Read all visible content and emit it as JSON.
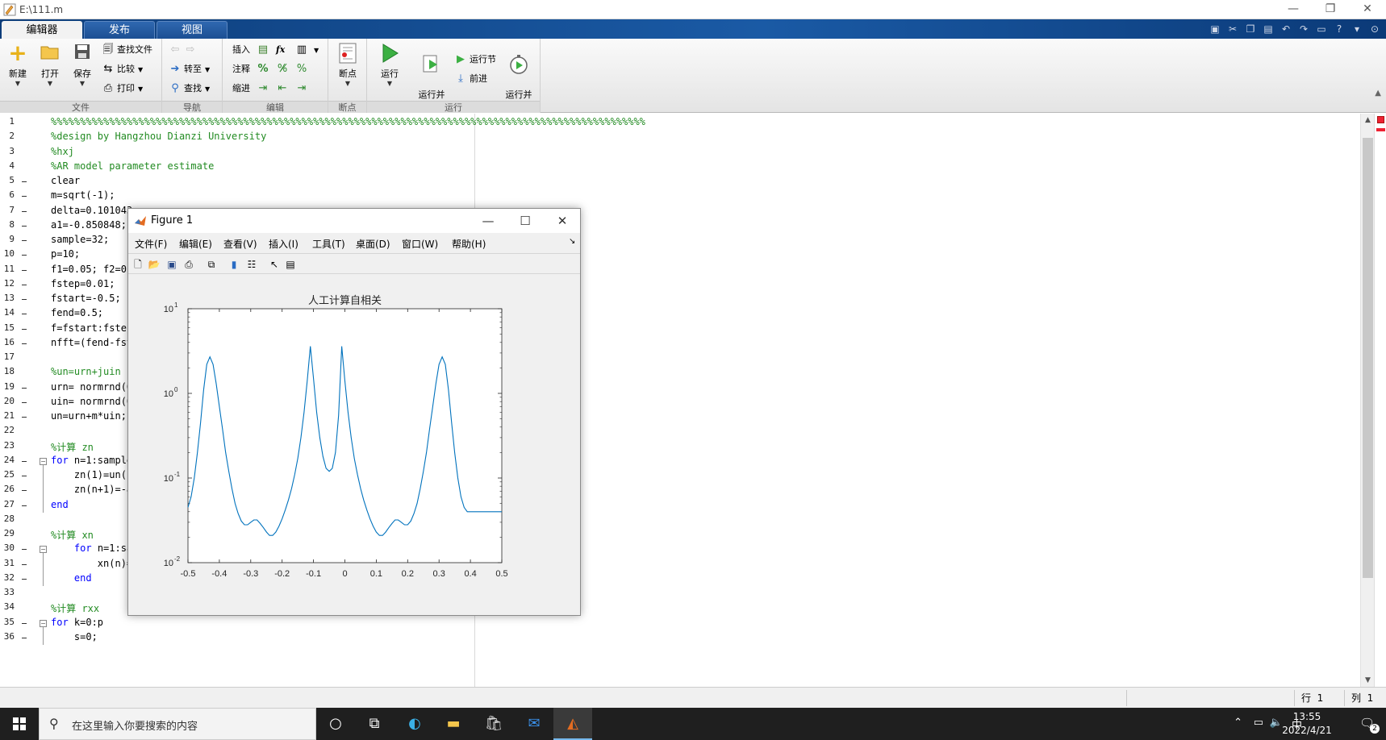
{
  "window": {
    "title": "E:\\111.m",
    "minimize": "—",
    "restore": "❐",
    "close": "✕"
  },
  "tabs": [
    {
      "label": "编辑器",
      "active": true
    },
    {
      "label": "发布",
      "active": false
    },
    {
      "label": "视图",
      "active": false
    }
  ],
  "ribbon": {
    "file": {
      "section": "文件",
      "new": "新建",
      "open": "打开",
      "save": "保存",
      "find_files": "查找文件",
      "compare": "比较",
      "print": "打印"
    },
    "navigate": {
      "section": "导航",
      "goto": "转至",
      "find": "查找"
    },
    "edit": {
      "section": "编辑",
      "insert": "插入",
      "comment": "注释",
      "indent": "缩进",
      "fx": "fx"
    },
    "breakpoints": {
      "section": "断点",
      "breakpoint": "断点"
    },
    "run": {
      "section": "运行",
      "run": "运行",
      "run_advance": "运行并\n前进",
      "run_section": "运行节",
      "advance": "前进",
      "run_time": "运行并\n计时"
    }
  },
  "editor": {
    "lines": [
      {
        "n": "1",
        "text": "%%%%%%%%%%%%%%%%%%%%%%%%%%%%%%%%%%%%%%%%%%%%%%%%%%%%%%%%%%%%%%%%%%%%%%%%%%%%%%%%%%%%%%%%%%%%%%%%%%%%%%",
        "type": "comment",
        "dash": false
      },
      {
        "n": "2",
        "text": "%design by Hangzhou Dianzi University",
        "type": "comment",
        "dash": false
      },
      {
        "n": "3",
        "text": "%hxj",
        "type": "comment",
        "dash": false
      },
      {
        "n": "4",
        "text": "%AR model parameter estimate",
        "type": "comment",
        "dash": false
      },
      {
        "n": "5",
        "text": "clear",
        "type": "code",
        "dash": true
      },
      {
        "n": "6",
        "text": "m=sqrt(-1);",
        "type": "code",
        "dash": true
      },
      {
        "n": "7",
        "text": "delta=0.101043",
        "type": "code",
        "dash": true
      },
      {
        "n": "8",
        "text": "a1=-0.850848;",
        "type": "code",
        "dash": true
      },
      {
        "n": "9",
        "text": "sample=32;",
        "type": "code",
        "dash": true
      },
      {
        "n": "10",
        "text": "p=10;",
        "type": "code",
        "dash": true
      },
      {
        "n": "11",
        "text": "f1=0.05; f2=0.",
        "type": "code",
        "dash": true
      },
      {
        "n": "12",
        "text": "fstep=0.01;",
        "type": "code",
        "dash": true
      },
      {
        "n": "13",
        "text": "fstart=-0.5;",
        "type": "code",
        "dash": true
      },
      {
        "n": "14",
        "text": "fend=0.5;",
        "type": "code",
        "dash": true
      },
      {
        "n": "15",
        "text": "f=fstart:fstep",
        "type": "code",
        "dash": true
      },
      {
        "n": "16",
        "text": "nfft=(fend-fst",
        "type": "code",
        "dash": true
      },
      {
        "n": "17",
        "text": "",
        "type": "code",
        "dash": false
      },
      {
        "n": "18",
        "text": "%un=urn+juin",
        "type": "comment",
        "dash": false
      },
      {
        "n": "19",
        "text": "urn= normrnd(0",
        "type": "code",
        "dash": true
      },
      {
        "n": "20",
        "text": "uin= normrnd(0",
        "type": "code",
        "dash": true
      },
      {
        "n": "21",
        "text": "un=urn+m*uin;",
        "type": "code",
        "dash": true
      },
      {
        "n": "22",
        "text": "",
        "type": "code",
        "dash": false
      },
      {
        "n": "23",
        "text": "%计算 zn",
        "type": "comment",
        "dash": false
      },
      {
        "n": "24",
        "text": "for n=1:sample",
        "type": "for",
        "dash": true
      },
      {
        "n": "25",
        "text": "    zn(1)=un(1",
        "type": "code",
        "dash": true
      },
      {
        "n": "26",
        "text": "    zn(n+1)=-a",
        "type": "code",
        "dash": true
      },
      {
        "n": "27",
        "text": "end",
        "type": "kw",
        "dash": true
      },
      {
        "n": "28",
        "text": "",
        "type": "code",
        "dash": false
      },
      {
        "n": "29",
        "text": "%计算 xn",
        "type": "comment",
        "dash": false
      },
      {
        "n": "30",
        "text": "    for n=1:sa",
        "type": "for",
        "dash": true
      },
      {
        "n": "31",
        "text": "        xn(n)=",
        "type": "code",
        "dash": true
      },
      {
        "n": "32",
        "text": "    end",
        "type": "kw",
        "dash": true
      },
      {
        "n": "33",
        "text": "",
        "type": "code",
        "dash": false
      },
      {
        "n": "34",
        "text": "%计算 rxx",
        "type": "comment",
        "dash": false
      },
      {
        "n": "35",
        "text": "for k=0:p",
        "type": "for",
        "dash": true
      },
      {
        "n": "36",
        "text": "    s=0;",
        "type": "code",
        "dash": true
      }
    ],
    "line31_tail": "));"
  },
  "statusbar": {
    "row_label": "行",
    "row_value": "1",
    "col_label": "列",
    "col_value": "1"
  },
  "taskbar": {
    "search_placeholder": "在这里输入你要搜索的内容",
    "time": "13:55",
    "date": "2022/4/21",
    "ime": "中",
    "notifications": "2"
  },
  "figure": {
    "title": "Figure 1",
    "menu": [
      "文件(F)",
      "编辑(E)",
      "查看(V)",
      "插入(I)",
      "工具(T)",
      "桌面(D)",
      "窗口(W)",
      "帮助(H)"
    ]
  },
  "chart_data": {
    "type": "line",
    "title": "人工计算自相关",
    "xlabel": "",
    "ylabel": "",
    "yscale": "log",
    "xlim": [
      -0.5,
      0.5
    ],
    "ylim": [
      0.01,
      10
    ],
    "xticks": [
      "-0.5",
      "-0.4",
      "-0.3",
      "-0.2",
      "-0.1",
      "0",
      "0.1",
      "0.2",
      "0.3",
      "0.4",
      "0.5"
    ],
    "yticks": [
      {
        "base": "10",
        "exp": "1"
      },
      {
        "base": "10",
        "exp": "0"
      },
      {
        "base": "10",
        "exp": "-1"
      },
      {
        "base": "10",
        "exp": "-2"
      }
    ],
    "color": "#0072BD",
    "grid": false,
    "x": [
      -0.5,
      -0.49,
      -0.48,
      -0.47,
      -0.46,
      -0.45,
      -0.44,
      -0.43,
      -0.42,
      -0.41,
      -0.4,
      -0.39,
      -0.38,
      -0.37,
      -0.36,
      -0.35,
      -0.34,
      -0.33,
      -0.32,
      -0.31,
      -0.3,
      -0.29,
      -0.28,
      -0.27,
      -0.26,
      -0.25,
      -0.24,
      -0.23,
      -0.22,
      -0.21,
      -0.2,
      -0.19,
      -0.18,
      -0.17,
      -0.16,
      -0.15,
      -0.14,
      -0.13,
      -0.12,
      -0.11,
      -0.1,
      -0.09,
      -0.08,
      -0.07,
      -0.06,
      -0.05,
      -0.04,
      -0.03,
      -0.02,
      -0.01,
      0.0,
      0.01,
      0.02,
      0.03,
      0.04,
      0.05,
      0.06,
      0.07,
      0.08,
      0.09,
      0.1,
      0.11,
      0.12,
      0.13,
      0.14,
      0.15,
      0.16,
      0.17,
      0.18,
      0.19,
      0.2,
      0.21,
      0.22,
      0.23,
      0.24,
      0.25,
      0.26,
      0.27,
      0.28,
      0.29,
      0.3,
      0.31,
      0.32,
      0.33,
      0.34,
      0.35,
      0.36,
      0.37,
      0.38,
      0.39,
      0.4,
      0.41,
      0.42,
      0.43,
      0.44,
      0.45,
      0.46,
      0.47,
      0.48,
      0.49,
      0.5
    ],
    "y": [
      0.045,
      0.06,
      0.1,
      0.2,
      0.45,
      1.1,
      2.2,
      2.7,
      2.2,
      1.3,
      0.7,
      0.38,
      0.2,
      0.12,
      0.075,
      0.05,
      0.038,
      0.031,
      0.028,
      0.028,
      0.03,
      0.032,
      0.032,
      0.029,
      0.026,
      0.023,
      0.021,
      0.021,
      0.023,
      0.027,
      0.033,
      0.042,
      0.055,
      0.075,
      0.11,
      0.17,
      0.3,
      0.6,
      1.4,
      3.6,
      1.5,
      0.6,
      0.3,
      0.18,
      0.13,
      0.12,
      0.13,
      0.2,
      0.55,
      3.6,
      1.4,
      0.6,
      0.3,
      0.17,
      0.11,
      0.075,
      0.055,
      0.042,
      0.033,
      0.027,
      0.023,
      0.021,
      0.021,
      0.023,
      0.026,
      0.029,
      0.032,
      0.032,
      0.03,
      0.028,
      0.028,
      0.031,
      0.038,
      0.05,
      0.075,
      0.12,
      0.2,
      0.38,
      0.7,
      1.3,
      2.2,
      2.7,
      2.2,
      1.1,
      0.45,
      0.2,
      0.1,
      0.06,
      0.045,
      0.04,
      0.04,
      0.04,
      0.04,
      0.04,
      0.04,
      0.04,
      0.04,
      0.04,
      0.04,
      0.04,
      0.04
    ]
  }
}
